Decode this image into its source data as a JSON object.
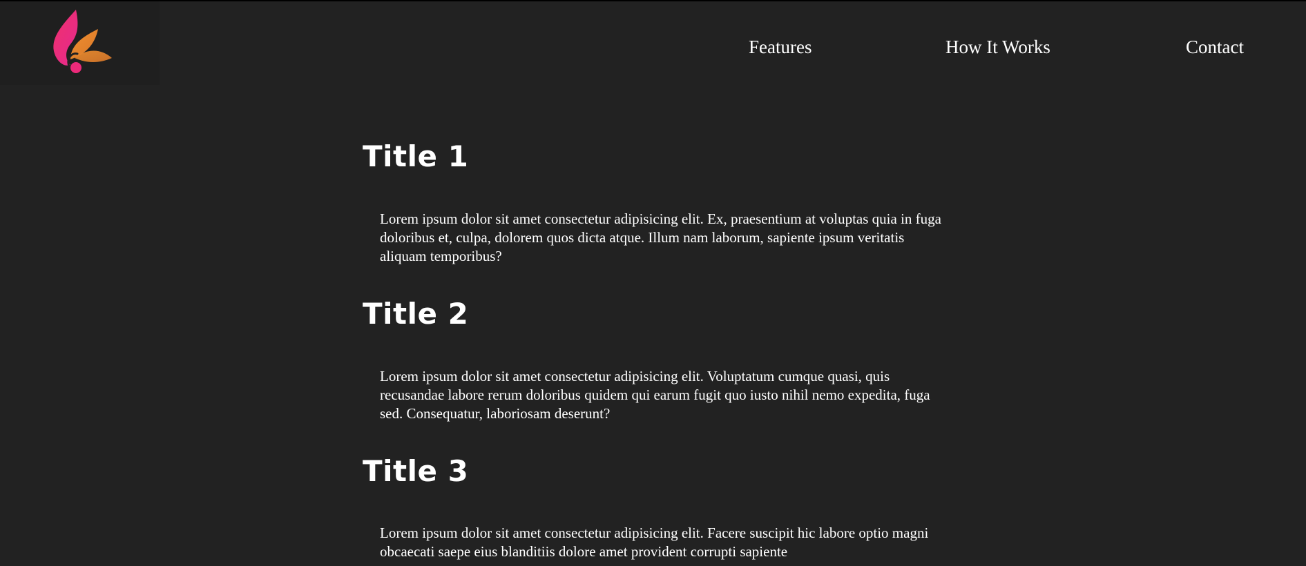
{
  "header": {
    "logo_icon": "flame-leaf-logo-icon",
    "colors": {
      "background": "#222222",
      "logo_panel": "#1f1f1f",
      "logo_pink": "#ee2a6b",
      "logo_orange": "#e98a2c"
    }
  },
  "nav": {
    "features": "Features",
    "how_it_works": "How It Works",
    "contact": "Contact"
  },
  "sections": [
    {
      "title": "Title 1",
      "text": "Lorem ipsum dolor sit amet consectetur adipisicing elit. Ex, praesentium at voluptas quia in fuga doloribus et, culpa, dolorem quos dicta atque. Illum nam laborum, sapiente ipsum veritatis aliquam temporibus?"
    },
    {
      "title": "Title 2",
      "text": "Lorem ipsum dolor sit amet consectetur adipisicing elit. Voluptatum cumque quasi, quis recusandae labore rerum doloribus quidem qui earum fugit quo iusto nihil nemo expedita, fuga sed. Consequatur, laboriosam deserunt?"
    },
    {
      "title": "Title 3",
      "text": "Lorem ipsum dolor sit amet consectetur adipisicing elit. Facere suscipit hic labore optio magni obcaecati saepe eius blanditiis dolore amet provident corrupti sapiente"
    }
  ]
}
